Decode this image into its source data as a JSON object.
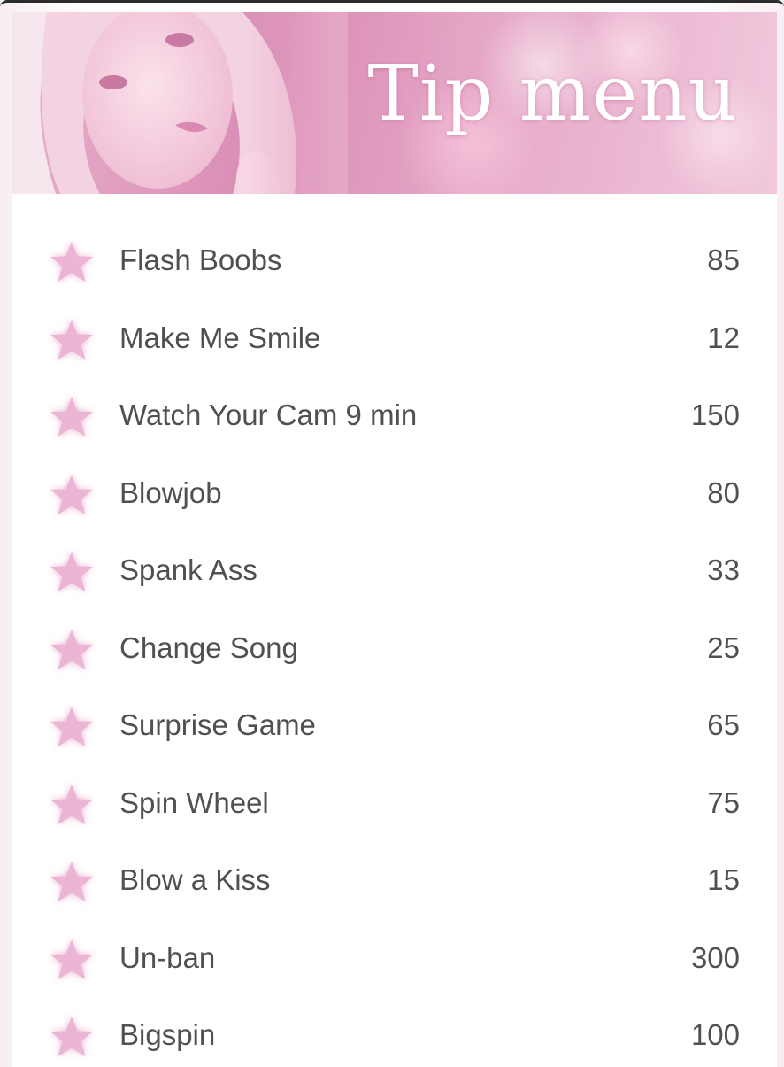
{
  "colors": {
    "accent_pink": "#e9b1cc",
    "star_pink": "#ecb5d3",
    "text": "#505050",
    "background": "#ffffff"
  },
  "header": {
    "title": "Tip menu",
    "image": "woman-portrait"
  },
  "menu": {
    "icon": "star-icon",
    "items": [
      {
        "label": "Flash Boobs",
        "price": "85"
      },
      {
        "label": "Make Me Smile",
        "price": "12"
      },
      {
        "label": "Watch Your Cam 9 min",
        "price": "150"
      },
      {
        "label": "Blowjob",
        "price": "80"
      },
      {
        "label": "Spank Ass",
        "price": "33"
      },
      {
        "label": "Change Song",
        "price": "25"
      },
      {
        "label": "Surprise Game",
        "price": "65"
      },
      {
        "label": "Spin Wheel",
        "price": "75"
      },
      {
        "label": "Blow a Kiss",
        "price": "15"
      },
      {
        "label": "Un-ban",
        "price": "300"
      },
      {
        "label": "Bigspin",
        "price": "100"
      }
    ]
  }
}
